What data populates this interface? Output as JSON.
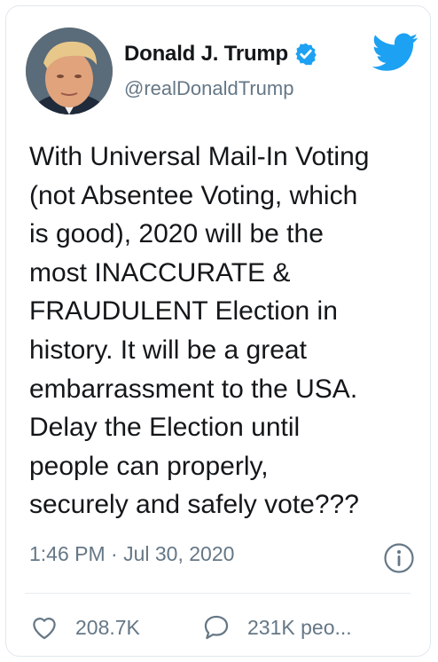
{
  "tweet": {
    "author_name": "Donald J. Trump",
    "handle": "@realDonaldTrump",
    "text": "With Universal Mail-In Voting\n(not Absentee Voting, which\nis good), 2020 will be the\nmost INACCURATE &\nFRAUDULENT Election in\nhistory. It will be a great\nembarrassment to the USA.\nDelay the Election until\npeople can properly,\nsecurely and safely vote???",
    "timestamp": "1:46 PM · Jul 30, 2020",
    "like_count": "208.7K",
    "people_count": "231K peo..."
  },
  "icons": {
    "verified": "verified-badge-icon",
    "brand": "twitter-bird-icon",
    "info": "info-icon",
    "like": "heart-icon",
    "reply": "speech-bubble-icon"
  },
  "colors": {
    "brand_blue": "#1da1f2",
    "text_primary": "#14171a",
    "text_secondary": "#657786",
    "border": "#e1e8ed"
  }
}
